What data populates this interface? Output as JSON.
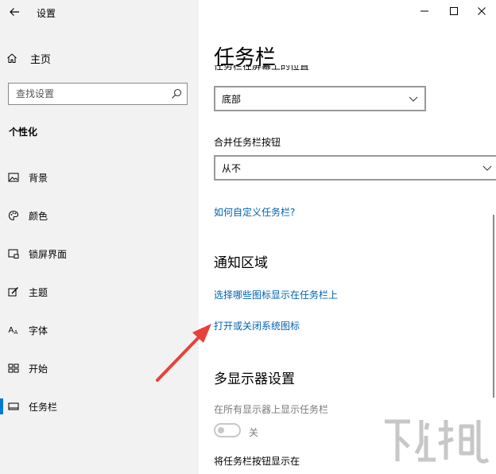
{
  "window": {
    "title": "设置"
  },
  "sidebar": {
    "home": "主页",
    "search": {
      "placeholder": "查找设置"
    },
    "section": "个性化",
    "items": [
      {
        "label": "背景",
        "icon": "picture-icon"
      },
      {
        "label": "颜色",
        "icon": "palette-icon"
      },
      {
        "label": "锁屏界面",
        "icon": "lock-screen-icon"
      },
      {
        "label": "主题",
        "icon": "theme-brush-icon"
      },
      {
        "label": "字体",
        "icon": "font-icon"
      },
      {
        "label": "开始",
        "icon": "start-menu-icon"
      },
      {
        "label": "任务栏",
        "icon": "taskbar-icon",
        "active": true
      }
    ]
  },
  "main": {
    "title": "任务栏",
    "location_label_partial": "任务栏在屏幕上的位置",
    "location_dropdown": {
      "value": "底部"
    },
    "combine_label": "合并任务栏按钮",
    "combine_dropdown": {
      "value": "从不"
    },
    "customize_link": "如何自定义任务栏?",
    "notification_heading": "通知区域",
    "select_icons_link": "选择哪些图标显示在任务栏上",
    "system_icons_link": "打开或关闭系统图标",
    "multi_display_heading": "多显示器设置",
    "show_all_displays_label": "在所有显示器上显示任务栏",
    "toggle": {
      "state": "关",
      "on": false
    },
    "show_buttons_label": "将任务栏按钮显示在"
  },
  "colors": {
    "accent": "#0078d7",
    "link": "#0063b1",
    "annotation_arrow": "#e8413a",
    "sidebar_bg": "#f2f2f2"
  },
  "watermark": {
    "text": "下载吧"
  }
}
